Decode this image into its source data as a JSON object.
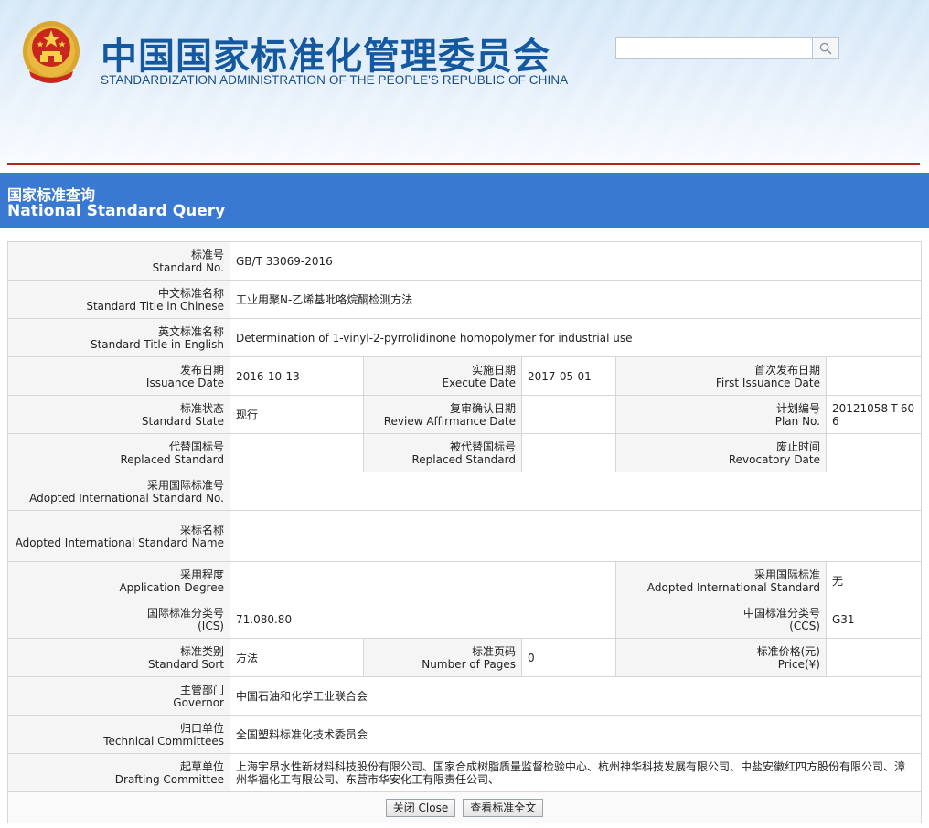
{
  "header": {
    "cn_title": "中国国家标准化管理委员会",
    "en_title": "STANDARDIZATION ADMINISTRATION OF THE PEOPLE'S REPUBLIC OF CHINA",
    "search": {
      "value": "",
      "placeholder": ""
    }
  },
  "banner": {
    "title_cn": "国家标准查询",
    "title_en": "National Standard Query"
  },
  "fields": {
    "standard_no": {
      "label_cn": "标准号",
      "label_en": "Standard No.",
      "value": "GB/T 33069-2016"
    },
    "title_cn": {
      "label_cn": "中文标准名称",
      "label_en": "Standard Title in Chinese",
      "value": "工业用聚N-乙烯基吡咯烷酮检测方法"
    },
    "title_en": {
      "label_cn": "英文标准名称",
      "label_en": "Standard Title in English",
      "value": "Determination of 1-vinyl-2-pyrrolidinone homopolymer for industrial use"
    },
    "issuance_date": {
      "label_cn": "发布日期",
      "label_en": "Issuance Date",
      "value": "2016-10-13"
    },
    "execute_date": {
      "label_cn": "实施日期",
      "label_en": "Execute Date",
      "value": "2017-05-01"
    },
    "first_issuance_date": {
      "label_cn": "首次发布日期",
      "label_en": "First Issuance Date",
      "value": ""
    },
    "standard_state": {
      "label_cn": "标准状态",
      "label_en": "Standard State",
      "value": "现行"
    },
    "review_date": {
      "label_cn": "复审确认日期",
      "label_en": "Review Affirmance Date",
      "value": ""
    },
    "plan_no": {
      "label_cn": "计划编号",
      "label_en": "Plan No.",
      "value": "20121058-T-606"
    },
    "replaced_standard_no": {
      "label_cn": "代替国标号",
      "label_en": "Replaced Standard",
      "value": ""
    },
    "replaced_by": {
      "label_cn": "被代替国标号",
      "label_en": "Replaced Standard",
      "value": ""
    },
    "revocatory_date": {
      "label_cn": "废止时间",
      "label_en": "Revocatory Date",
      "value": ""
    },
    "adopted_intl_no": {
      "label_cn": "采用国际标准号",
      "label_en": "Adopted International Standard No.",
      "value": ""
    },
    "adopted_intl_name": {
      "label_cn": "采标名称",
      "label_en": "Adopted International Standard Name",
      "value": ""
    },
    "application_degree": {
      "label_cn": "采用程度",
      "label_en": "Application Degree",
      "value": ""
    },
    "adopted_intl": {
      "label_cn": "采用国际标准",
      "label_en": "Adopted International Standard",
      "value": "无"
    },
    "ics": {
      "label_cn": "国际标准分类号",
      "label_en": "(ICS)",
      "value": "71.080.80"
    },
    "ccs": {
      "label_cn": "中国标准分类号",
      "label_en": "(CCS)",
      "value": "G31"
    },
    "standard_sort": {
      "label_cn": "标准类别",
      "label_en": "Standard Sort",
      "value": "方法"
    },
    "pages": {
      "label_cn": "标准页码",
      "label_en": "Number of Pages",
      "value": "0"
    },
    "price": {
      "label_cn": "标准价格(元)",
      "label_en": "Price(¥)",
      "value": ""
    },
    "governor": {
      "label_cn": "主管部门",
      "label_en": "Governor",
      "value": "中国石油和化学工业联合会"
    },
    "technical_committees": {
      "label_cn": "归口单位",
      "label_en": "Technical Committees",
      "value": "全国塑料标准化技术委员会"
    },
    "drafting_committee": {
      "label_cn": "起草单位",
      "label_en": "Drafting Committee",
      "value": "上海宇昂水性新材料科技股份有限公司、国家合成树脂质量监督检验中心、杭州神华科技发展有限公司、中盐安徽红四方股份有限公司、漳州华福化工有限公司、东营市华安化工有限责任公司、"
    }
  },
  "buttons": {
    "close": "关闭 Close",
    "view_full": "查看标准全文"
  },
  "colors": {
    "banner_blue": "#3a79d2",
    "title_blue": "#14599f",
    "divider_red": "#b1261c",
    "label_bg": "#f5f5f5"
  },
  "icons": {
    "emblem": "national-emblem",
    "search": "magnifier"
  }
}
